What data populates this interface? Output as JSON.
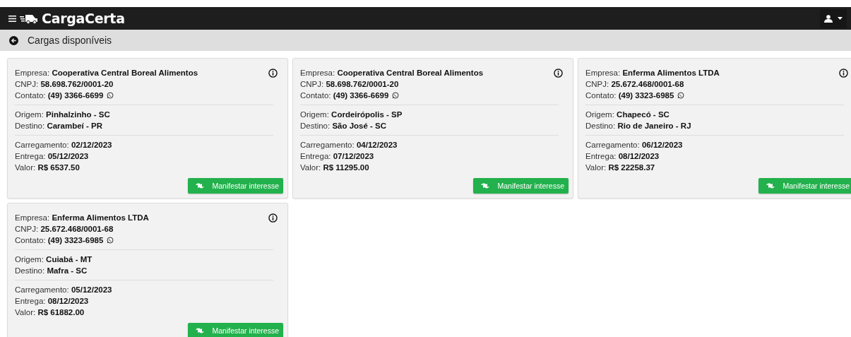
{
  "app": {
    "title": "CargaCerta"
  },
  "page": {
    "title": "Cargas disponíveis"
  },
  "cards": [
    {
      "sections": [
        [
          "Empresa: **Cooperativa Central Boreal Alimentos**",
          "CNPJ: **58.698.762/0001-20**",
          "Contato: **(49) 3366-6699**"
        ],
        [
          "Origem: **Pinhalzinho - SC**",
          "Destino: **Carambeí - PR**"
        ],
        [
          "Carregamento: **02/12/2023**",
          "Entrega: **05/12/2023**",
          "Valor: **R$ 6537.50**"
        ]
      ],
      "button": "Manifestar interesse"
    },
    {
      "sections": [
        [
          "Empresa: **Cooperativa Central Boreal Alimentos**",
          "CNPJ: **58.698.762/0001-20**",
          "Contato: **(49) 3366-6699**"
        ],
        [
          "Origem: **Cordeirópolis - SP**",
          "Destino: **São José - SC**"
        ],
        [
          "Carregamento: **04/12/2023**",
          "Entrega: **07/12/2023**",
          "Valor: **R$ 11295.00**"
        ]
      ],
      "button": "Manifestar interesse"
    },
    {
      "sections": [
        [
          "Empresa: **Enferma Alimentos LTDA**",
          "CNPJ: **25.672.468/0001-68**",
          "Contato: **(49) 3323-6985**"
        ],
        [
          "Origem: **Chapecó - SC**",
          "Destino: **Rio de Janeiro - RJ**"
        ],
        [
          "Carregamento: **06/12/2023**",
          "Entrega: **08/12/2023**",
          "Valor: **R$ 22258.37**"
        ]
      ],
      "button": "Manifestar interesse"
    },
    {
      "sections": [
        [
          "Empresa: **Enferma Alimentos LTDA**",
          "CNPJ: **25.672.468/0001-68**",
          "Contato: **(49) 3323-6985**"
        ],
        [
          "Origem: **Cuiabá - MT**",
          "Destino: **Mafra - SC**"
        ],
        [
          "Carregamento: **05/12/2023**",
          "Entrega: **08/12/2023**",
          "Valor: **R$ 61882.00**"
        ]
      ],
      "button": "Manifestar interesse"
    }
  ]
}
